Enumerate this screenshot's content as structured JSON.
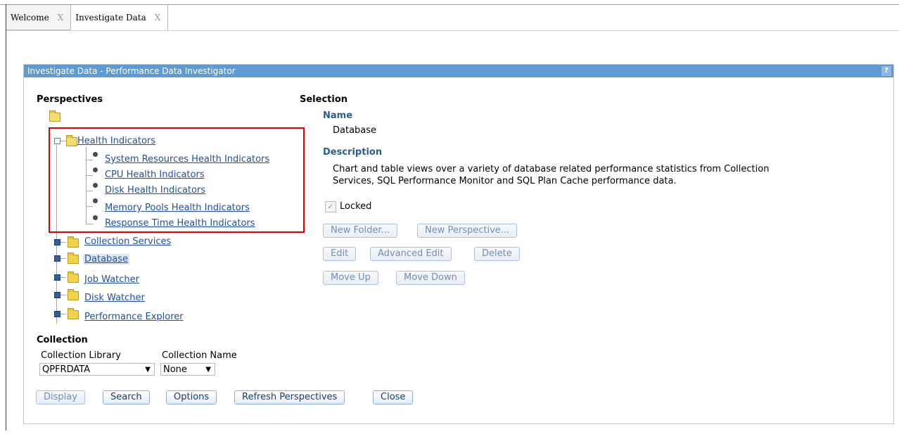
{
  "tabs": [
    {
      "label": "Welcome",
      "close": "X"
    },
    {
      "label": "Investigate Data",
      "close": "X"
    }
  ],
  "panel": {
    "title": "Investigate Data - Performance Data Investigator",
    "help": "?"
  },
  "perspectives": {
    "heading": "Perspectives",
    "tree": [
      {
        "label": "Health Indicators",
        "expanded": true,
        "children": [
          "System Resources Health Indicators",
          "CPU Health Indicators",
          "Disk Health Indicators",
          "Memory Pools Health Indicators",
          "Response Time Health Indicators"
        ]
      },
      {
        "label": "Collection Services"
      },
      {
        "label": "Database",
        "selected": true
      },
      {
        "label": "Job Watcher"
      },
      {
        "label": "Disk Watcher"
      },
      {
        "label": "Performance Explorer"
      }
    ]
  },
  "selection": {
    "heading": "Selection",
    "name_label": "Name",
    "name_value": "Database",
    "description_label": "Description",
    "description_line1": "Chart and table views over a variety of database related performance statistics from Collection",
    "description_line2": "Services, SQL Performance Monitor and SQL Plan Cache performance data.",
    "locked_label": "Locked",
    "locked_checked": true,
    "buttons": {
      "new_folder": "New Folder...",
      "new_perspective": "New Perspective...",
      "edit": "Edit",
      "advanced_edit": "Advanced Edit",
      "delete": "Delete",
      "move_up": "Move Up",
      "move_down": "Move Down"
    }
  },
  "collection": {
    "heading": "Collection",
    "library_label": "Collection Library",
    "library_value": "QPFRDATA",
    "name_label": "Collection Name",
    "name_value": "None"
  },
  "bottom_buttons": {
    "display": "Display",
    "search": "Search",
    "options": "Options",
    "refresh": "Refresh Perspectives",
    "close": "Close"
  },
  "colors": {
    "title_bar": "#5e9ad3",
    "link": "#1f4fa3",
    "highlight_box": "#e00000"
  }
}
